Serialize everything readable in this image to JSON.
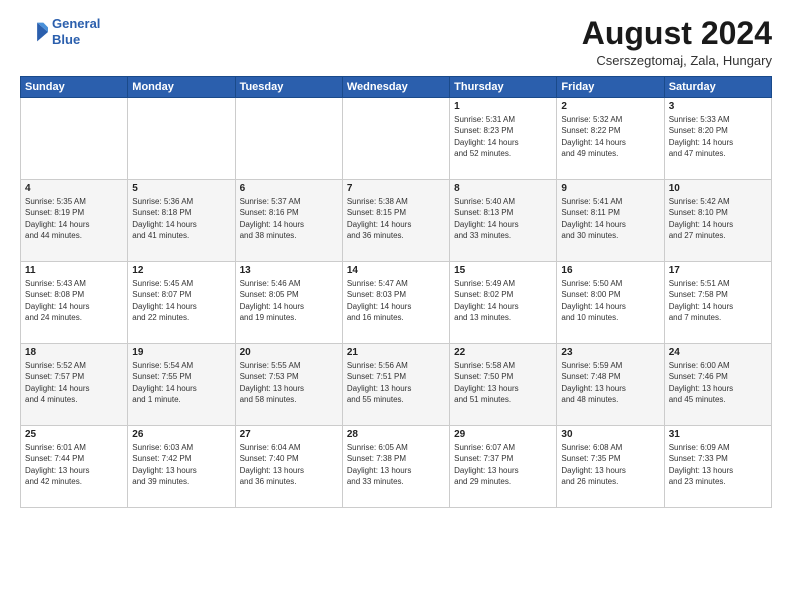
{
  "header": {
    "logo_line1": "General",
    "logo_line2": "Blue",
    "title": "August 2024",
    "location": "Cserszegtomaj, Zala, Hungary"
  },
  "days_of_week": [
    "Sunday",
    "Monday",
    "Tuesday",
    "Wednesday",
    "Thursday",
    "Friday",
    "Saturday"
  ],
  "weeks": [
    [
      {
        "day": "",
        "content": ""
      },
      {
        "day": "",
        "content": ""
      },
      {
        "day": "",
        "content": ""
      },
      {
        "day": "",
        "content": ""
      },
      {
        "day": "1",
        "content": "Sunrise: 5:31 AM\nSunset: 8:23 PM\nDaylight: 14 hours\nand 52 minutes."
      },
      {
        "day": "2",
        "content": "Sunrise: 5:32 AM\nSunset: 8:22 PM\nDaylight: 14 hours\nand 49 minutes."
      },
      {
        "day": "3",
        "content": "Sunrise: 5:33 AM\nSunset: 8:20 PM\nDaylight: 14 hours\nand 47 minutes."
      }
    ],
    [
      {
        "day": "4",
        "content": "Sunrise: 5:35 AM\nSunset: 8:19 PM\nDaylight: 14 hours\nand 44 minutes."
      },
      {
        "day": "5",
        "content": "Sunrise: 5:36 AM\nSunset: 8:18 PM\nDaylight: 14 hours\nand 41 minutes."
      },
      {
        "day": "6",
        "content": "Sunrise: 5:37 AM\nSunset: 8:16 PM\nDaylight: 14 hours\nand 38 minutes."
      },
      {
        "day": "7",
        "content": "Sunrise: 5:38 AM\nSunset: 8:15 PM\nDaylight: 14 hours\nand 36 minutes."
      },
      {
        "day": "8",
        "content": "Sunrise: 5:40 AM\nSunset: 8:13 PM\nDaylight: 14 hours\nand 33 minutes."
      },
      {
        "day": "9",
        "content": "Sunrise: 5:41 AM\nSunset: 8:11 PM\nDaylight: 14 hours\nand 30 minutes."
      },
      {
        "day": "10",
        "content": "Sunrise: 5:42 AM\nSunset: 8:10 PM\nDaylight: 14 hours\nand 27 minutes."
      }
    ],
    [
      {
        "day": "11",
        "content": "Sunrise: 5:43 AM\nSunset: 8:08 PM\nDaylight: 14 hours\nand 24 minutes."
      },
      {
        "day": "12",
        "content": "Sunrise: 5:45 AM\nSunset: 8:07 PM\nDaylight: 14 hours\nand 22 minutes."
      },
      {
        "day": "13",
        "content": "Sunrise: 5:46 AM\nSunset: 8:05 PM\nDaylight: 14 hours\nand 19 minutes."
      },
      {
        "day": "14",
        "content": "Sunrise: 5:47 AM\nSunset: 8:03 PM\nDaylight: 14 hours\nand 16 minutes."
      },
      {
        "day": "15",
        "content": "Sunrise: 5:49 AM\nSunset: 8:02 PM\nDaylight: 14 hours\nand 13 minutes."
      },
      {
        "day": "16",
        "content": "Sunrise: 5:50 AM\nSunset: 8:00 PM\nDaylight: 14 hours\nand 10 minutes."
      },
      {
        "day": "17",
        "content": "Sunrise: 5:51 AM\nSunset: 7:58 PM\nDaylight: 14 hours\nand 7 minutes."
      }
    ],
    [
      {
        "day": "18",
        "content": "Sunrise: 5:52 AM\nSunset: 7:57 PM\nDaylight: 14 hours\nand 4 minutes."
      },
      {
        "day": "19",
        "content": "Sunrise: 5:54 AM\nSunset: 7:55 PM\nDaylight: 14 hours\nand 1 minute."
      },
      {
        "day": "20",
        "content": "Sunrise: 5:55 AM\nSunset: 7:53 PM\nDaylight: 13 hours\nand 58 minutes."
      },
      {
        "day": "21",
        "content": "Sunrise: 5:56 AM\nSunset: 7:51 PM\nDaylight: 13 hours\nand 55 minutes."
      },
      {
        "day": "22",
        "content": "Sunrise: 5:58 AM\nSunset: 7:50 PM\nDaylight: 13 hours\nand 51 minutes."
      },
      {
        "day": "23",
        "content": "Sunrise: 5:59 AM\nSunset: 7:48 PM\nDaylight: 13 hours\nand 48 minutes."
      },
      {
        "day": "24",
        "content": "Sunrise: 6:00 AM\nSunset: 7:46 PM\nDaylight: 13 hours\nand 45 minutes."
      }
    ],
    [
      {
        "day": "25",
        "content": "Sunrise: 6:01 AM\nSunset: 7:44 PM\nDaylight: 13 hours\nand 42 minutes."
      },
      {
        "day": "26",
        "content": "Sunrise: 6:03 AM\nSunset: 7:42 PM\nDaylight: 13 hours\nand 39 minutes."
      },
      {
        "day": "27",
        "content": "Sunrise: 6:04 AM\nSunset: 7:40 PM\nDaylight: 13 hours\nand 36 minutes."
      },
      {
        "day": "28",
        "content": "Sunrise: 6:05 AM\nSunset: 7:38 PM\nDaylight: 13 hours\nand 33 minutes."
      },
      {
        "day": "29",
        "content": "Sunrise: 6:07 AM\nSunset: 7:37 PM\nDaylight: 13 hours\nand 29 minutes."
      },
      {
        "day": "30",
        "content": "Sunrise: 6:08 AM\nSunset: 7:35 PM\nDaylight: 13 hours\nand 26 minutes."
      },
      {
        "day": "31",
        "content": "Sunrise: 6:09 AM\nSunset: 7:33 PM\nDaylight: 13 hours\nand 23 minutes."
      }
    ]
  ]
}
